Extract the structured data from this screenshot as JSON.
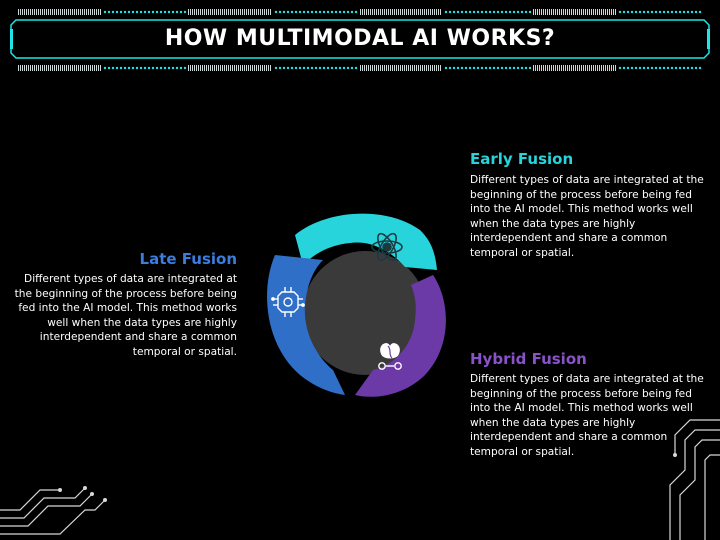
{
  "title": "HOW MULTIMODAL AI WORKS?",
  "colors": {
    "accent_cyan": "#1ee6e8",
    "early": "#27d4dc",
    "late": "#2f6fc7",
    "hybrid": "#6b3aa6",
    "late_title": "#3b7ee0",
    "hybrid_title": "#8a52c8",
    "center": "#3a3a3a",
    "background": "#000000"
  },
  "sections": {
    "early": {
      "title": "Early Fusion",
      "body": "Different types of data are integrated at the beginning of the process before being fed into the AI model. This method works well when the data types are highly interdependent and share a common temporal or spatial."
    },
    "late": {
      "title": "Late Fusion",
      "body": "Different types of data are integrated at the beginning of the process before being fed into the AI model. This method works well when the data types are highly interdependent and share a common temporal or spatial."
    },
    "hybrid": {
      "title": "Hybrid Fusion",
      "body": "Different types of data are integrated at the beginning of the process before being fed into the AI model. This method works well when the data types are highly interdependent and share a common temporal or spatial."
    }
  },
  "icons": {
    "early": "atom-brain-icon",
    "late": "chip-brain-icon",
    "hybrid": "brain-dna-gears-icon"
  }
}
